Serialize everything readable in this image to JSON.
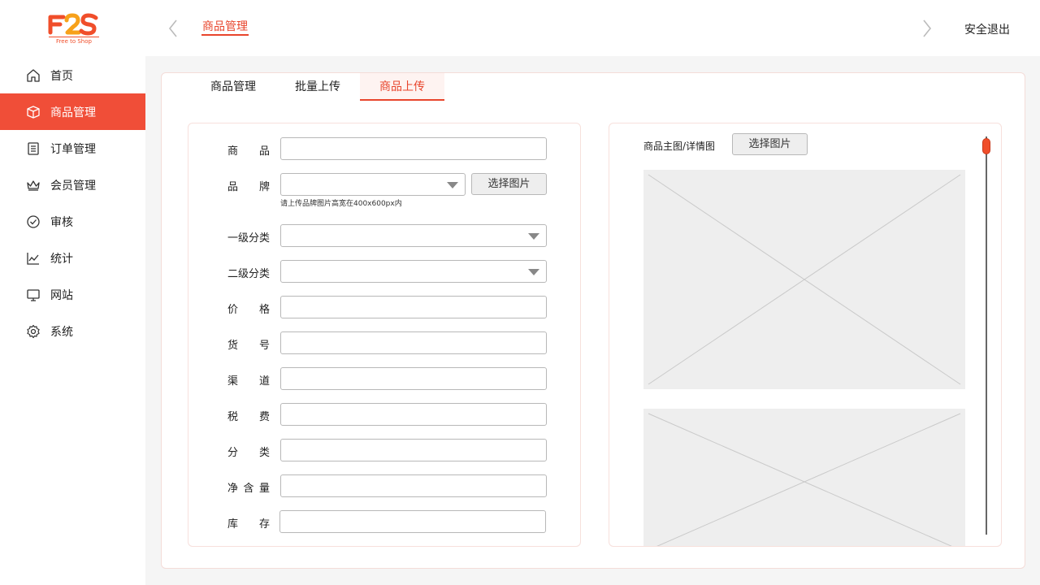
{
  "brand": {
    "name": "F2S",
    "tagline": "Free to Shop",
    "color": "#f04e2a"
  },
  "sidebar": {
    "items": [
      {
        "label": "首页",
        "icon": "home-icon",
        "active": false
      },
      {
        "label": "商品管理",
        "icon": "box-icon",
        "active": true
      },
      {
        "label": "订单管理",
        "icon": "clipboard-icon",
        "active": false
      },
      {
        "label": "会员管理",
        "icon": "crown-icon",
        "active": false
      },
      {
        "label": "审核",
        "icon": "check-circle-icon",
        "active": false
      },
      {
        "label": "统计",
        "icon": "line-chart-icon",
        "active": false
      },
      {
        "label": "网站",
        "icon": "monitor-icon",
        "active": false
      },
      {
        "label": "系统",
        "icon": "gear-icon",
        "active": false
      }
    ]
  },
  "header": {
    "tab": "商品管理",
    "logout": "安全退出"
  },
  "tabs": [
    {
      "label": "商品管理",
      "active": false
    },
    {
      "label": "批量上传",
      "active": false
    },
    {
      "label": "商品上传",
      "active": true
    }
  ],
  "form": {
    "product": {
      "c1": "商",
      "c2": "品",
      "value": ""
    },
    "brand": {
      "c1": "品",
      "c2": "牌",
      "value": "",
      "button": "选择图片",
      "hint": "请上传品牌图片高宽在400x600px内"
    },
    "category1": {
      "label": "一级分类",
      "value": ""
    },
    "category2": {
      "label": "二级分类",
      "value": ""
    },
    "price": {
      "c1": "价",
      "c2": "格",
      "value": ""
    },
    "sku": {
      "c1": "货",
      "c2": "号",
      "value": ""
    },
    "channel": {
      "c1": "渠",
      "c2": "道",
      "value": ""
    },
    "tax": {
      "c1": "税",
      "c2": "费",
      "value": ""
    },
    "classify": {
      "c1": "分",
      "c2": "类",
      "value": ""
    },
    "net": {
      "c1": "净",
      "c2": "含",
      "c3": "量",
      "value": ""
    },
    "stock": {
      "c1": "库",
      "c2": "存",
      "value": ""
    }
  },
  "images": {
    "title": "商品主图/详情图",
    "button": "选择图片"
  },
  "colors": {
    "accent": "#e8452c",
    "active_nav": "#f04e38",
    "page_bg": "#f5f5f5"
  }
}
